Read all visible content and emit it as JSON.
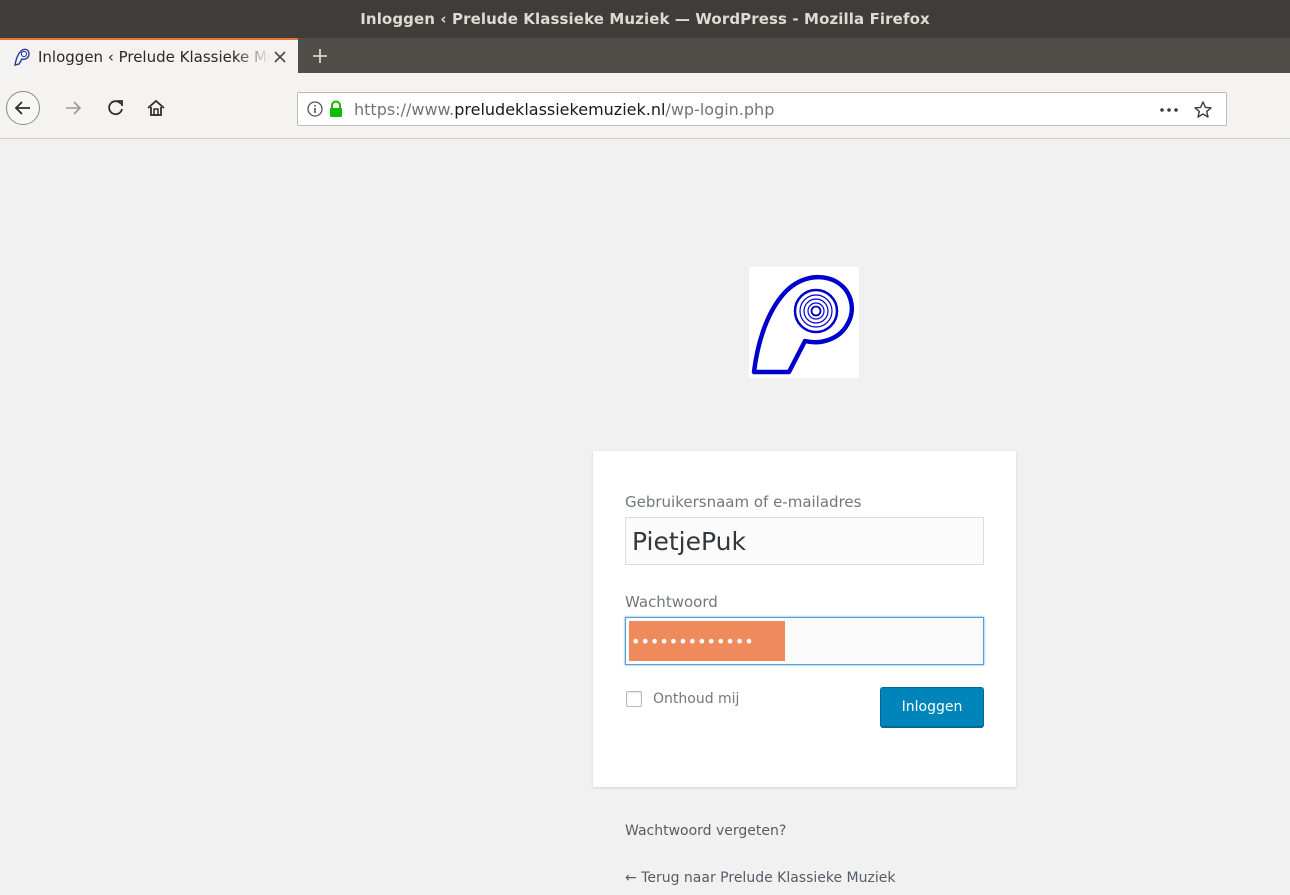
{
  "window": {
    "title": "Inloggen ‹ Prelude Klassieke Muziek — WordPress - Mozilla Firefox"
  },
  "tab": {
    "title": "Inloggen ‹ Prelude Klassieke Muziek — WordPress",
    "favicon": "prelude-p-icon",
    "close_icon": "close-icon"
  },
  "toolbar": {
    "new_tab_icon": "plus-icon",
    "back_icon": "back-arrow-icon",
    "forward_icon": "forward-arrow-icon",
    "reload_icon": "reload-icon",
    "home_icon": "home-icon"
  },
  "urlbar": {
    "prefix": "https://www.",
    "domain": "preludeklassiekemuziek.nl",
    "path": "/wp-login.php",
    "info_icon": "info-icon",
    "lock_icon": "lock-icon",
    "lock_color": "#12bc00",
    "page_actions_icon": "more-horizontal-icon",
    "bookmark_icon": "star-icon"
  },
  "login": {
    "logo": "prelude-logo",
    "logo_color": "#0000cc",
    "username_label": "Gebruikersnaam of e-mailadres",
    "username_value": "PietjePuk",
    "password_label": "Wachtwoord",
    "password_mask": "•••••••••••••",
    "password_highlight_color": "#ef8a5d",
    "remember_label": "Onthoud mij",
    "remember_checked": false,
    "submit_label": "Inloggen",
    "submit_color": "#0085ba"
  },
  "links": {
    "lost_password": "Wachtwoord vergeten?",
    "back_to_blog": "← Terug naar Prelude Klassieke Muziek"
  }
}
